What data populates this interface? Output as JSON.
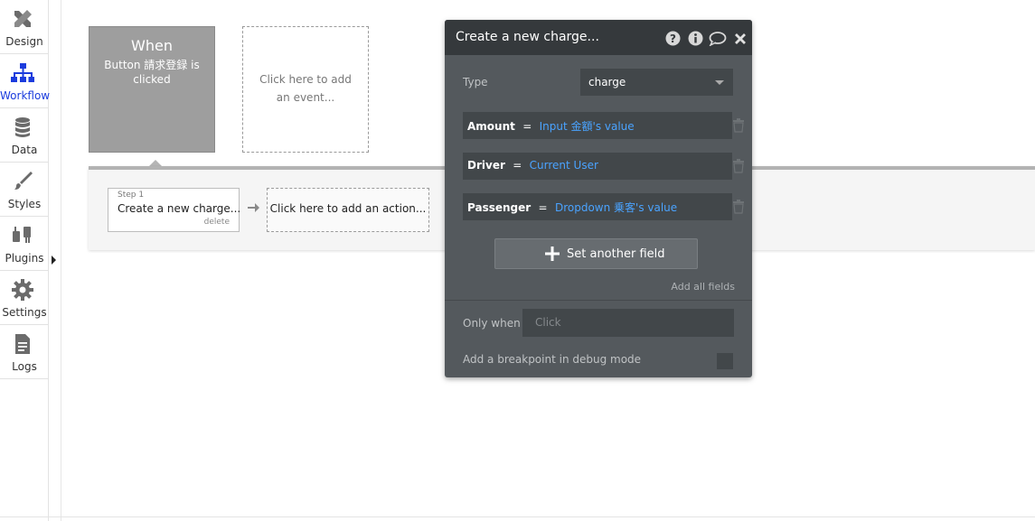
{
  "sidebar": {
    "items": [
      {
        "label": "Design",
        "icon": "design-icon"
      },
      {
        "label": "Workflow",
        "icon": "workflow-icon",
        "active": true
      },
      {
        "label": "Data",
        "icon": "database-icon"
      },
      {
        "label": "Styles",
        "icon": "brush-icon"
      },
      {
        "label": "Plugins",
        "icon": "plug-icon"
      },
      {
        "label": "Settings",
        "icon": "gear-icon"
      },
      {
        "label": "Logs",
        "icon": "document-icon"
      }
    ],
    "active_color": "#1b3cdd"
  },
  "event": {
    "when": "When",
    "description": "Button 請求登録 is clicked",
    "add_event": "Click here to add an event..."
  },
  "workflow": {
    "step_number": "Step 1",
    "step_title": "Create a new charge...",
    "step_delete": "delete",
    "add_action": "Click here to add an action..."
  },
  "panel": {
    "title": "Create a new charge...",
    "header_icons": [
      "help-icon",
      "info-icon",
      "comment-icon",
      "close-icon"
    ],
    "type_label": "Type",
    "type_value": "charge",
    "fields": [
      {
        "name": "Amount",
        "eq": "=",
        "value": "Input 金額's value"
      },
      {
        "name": "Driver",
        "eq": "=",
        "value": "Current User"
      },
      {
        "name": "Passenger",
        "eq": "=",
        "value": "Dropdown 乗客's value"
      }
    ],
    "set_another_field": "Set another field",
    "add_all_fields": "Add all fields",
    "only_when_label": "Only when",
    "only_when_placeholder": "Click",
    "breakpoint_label": "Add a breakpoint in debug mode",
    "value_color": "#4aa3ff"
  }
}
